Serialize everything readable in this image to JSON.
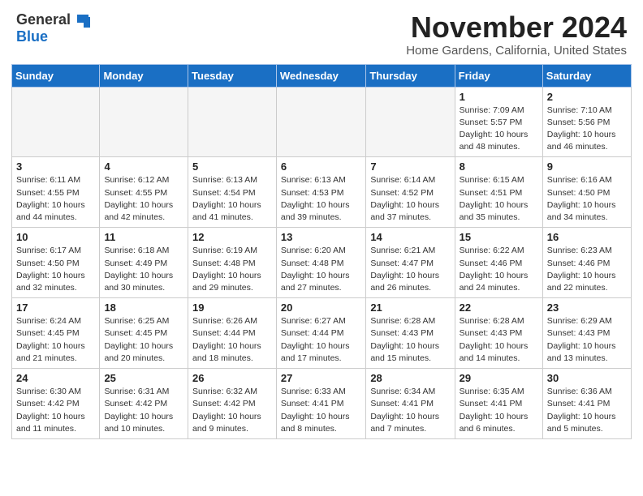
{
  "header": {
    "logo_general": "General",
    "logo_blue": "Blue",
    "month_title": "November 2024",
    "location": "Home Gardens, California, United States"
  },
  "weekdays": [
    "Sunday",
    "Monday",
    "Tuesday",
    "Wednesday",
    "Thursday",
    "Friday",
    "Saturday"
  ],
  "weeks": [
    [
      {
        "day": "",
        "empty": true
      },
      {
        "day": "",
        "empty": true
      },
      {
        "day": "",
        "empty": true
      },
      {
        "day": "",
        "empty": true
      },
      {
        "day": "",
        "empty": true
      },
      {
        "day": "1",
        "sunrise": "Sunrise: 7:09 AM",
        "sunset": "Sunset: 5:57 PM",
        "daylight": "Daylight: 10 hours and 48 minutes."
      },
      {
        "day": "2",
        "sunrise": "Sunrise: 7:10 AM",
        "sunset": "Sunset: 5:56 PM",
        "daylight": "Daylight: 10 hours and 46 minutes."
      }
    ],
    [
      {
        "day": "3",
        "sunrise": "Sunrise: 6:11 AM",
        "sunset": "Sunset: 4:55 PM",
        "daylight": "Daylight: 10 hours and 44 minutes."
      },
      {
        "day": "4",
        "sunrise": "Sunrise: 6:12 AM",
        "sunset": "Sunset: 4:55 PM",
        "daylight": "Daylight: 10 hours and 42 minutes."
      },
      {
        "day": "5",
        "sunrise": "Sunrise: 6:13 AM",
        "sunset": "Sunset: 4:54 PM",
        "daylight": "Daylight: 10 hours and 41 minutes."
      },
      {
        "day": "6",
        "sunrise": "Sunrise: 6:13 AM",
        "sunset": "Sunset: 4:53 PM",
        "daylight": "Daylight: 10 hours and 39 minutes."
      },
      {
        "day": "7",
        "sunrise": "Sunrise: 6:14 AM",
        "sunset": "Sunset: 4:52 PM",
        "daylight": "Daylight: 10 hours and 37 minutes."
      },
      {
        "day": "8",
        "sunrise": "Sunrise: 6:15 AM",
        "sunset": "Sunset: 4:51 PM",
        "daylight": "Daylight: 10 hours and 35 minutes."
      },
      {
        "day": "9",
        "sunrise": "Sunrise: 6:16 AM",
        "sunset": "Sunset: 4:50 PM",
        "daylight": "Daylight: 10 hours and 34 minutes."
      }
    ],
    [
      {
        "day": "10",
        "sunrise": "Sunrise: 6:17 AM",
        "sunset": "Sunset: 4:50 PM",
        "daylight": "Daylight: 10 hours and 32 minutes."
      },
      {
        "day": "11",
        "sunrise": "Sunrise: 6:18 AM",
        "sunset": "Sunset: 4:49 PM",
        "daylight": "Daylight: 10 hours and 30 minutes."
      },
      {
        "day": "12",
        "sunrise": "Sunrise: 6:19 AM",
        "sunset": "Sunset: 4:48 PM",
        "daylight": "Daylight: 10 hours and 29 minutes."
      },
      {
        "day": "13",
        "sunrise": "Sunrise: 6:20 AM",
        "sunset": "Sunset: 4:48 PM",
        "daylight": "Daylight: 10 hours and 27 minutes."
      },
      {
        "day": "14",
        "sunrise": "Sunrise: 6:21 AM",
        "sunset": "Sunset: 4:47 PM",
        "daylight": "Daylight: 10 hours and 26 minutes."
      },
      {
        "day": "15",
        "sunrise": "Sunrise: 6:22 AM",
        "sunset": "Sunset: 4:46 PM",
        "daylight": "Daylight: 10 hours and 24 minutes."
      },
      {
        "day": "16",
        "sunrise": "Sunrise: 6:23 AM",
        "sunset": "Sunset: 4:46 PM",
        "daylight": "Daylight: 10 hours and 22 minutes."
      }
    ],
    [
      {
        "day": "17",
        "sunrise": "Sunrise: 6:24 AM",
        "sunset": "Sunset: 4:45 PM",
        "daylight": "Daylight: 10 hours and 21 minutes."
      },
      {
        "day": "18",
        "sunrise": "Sunrise: 6:25 AM",
        "sunset": "Sunset: 4:45 PM",
        "daylight": "Daylight: 10 hours and 20 minutes."
      },
      {
        "day": "19",
        "sunrise": "Sunrise: 6:26 AM",
        "sunset": "Sunset: 4:44 PM",
        "daylight": "Daylight: 10 hours and 18 minutes."
      },
      {
        "day": "20",
        "sunrise": "Sunrise: 6:27 AM",
        "sunset": "Sunset: 4:44 PM",
        "daylight": "Daylight: 10 hours and 17 minutes."
      },
      {
        "day": "21",
        "sunrise": "Sunrise: 6:28 AM",
        "sunset": "Sunset: 4:43 PM",
        "daylight": "Daylight: 10 hours and 15 minutes."
      },
      {
        "day": "22",
        "sunrise": "Sunrise: 6:28 AM",
        "sunset": "Sunset: 4:43 PM",
        "daylight": "Daylight: 10 hours and 14 minutes."
      },
      {
        "day": "23",
        "sunrise": "Sunrise: 6:29 AM",
        "sunset": "Sunset: 4:43 PM",
        "daylight": "Daylight: 10 hours and 13 minutes."
      }
    ],
    [
      {
        "day": "24",
        "sunrise": "Sunrise: 6:30 AM",
        "sunset": "Sunset: 4:42 PM",
        "daylight": "Daylight: 10 hours and 11 minutes."
      },
      {
        "day": "25",
        "sunrise": "Sunrise: 6:31 AM",
        "sunset": "Sunset: 4:42 PM",
        "daylight": "Daylight: 10 hours and 10 minutes."
      },
      {
        "day": "26",
        "sunrise": "Sunrise: 6:32 AM",
        "sunset": "Sunset: 4:42 PM",
        "daylight": "Daylight: 10 hours and 9 minutes."
      },
      {
        "day": "27",
        "sunrise": "Sunrise: 6:33 AM",
        "sunset": "Sunset: 4:41 PM",
        "daylight": "Daylight: 10 hours and 8 minutes."
      },
      {
        "day": "28",
        "sunrise": "Sunrise: 6:34 AM",
        "sunset": "Sunset: 4:41 PM",
        "daylight": "Daylight: 10 hours and 7 minutes."
      },
      {
        "day": "29",
        "sunrise": "Sunrise: 6:35 AM",
        "sunset": "Sunset: 4:41 PM",
        "daylight": "Daylight: 10 hours and 6 minutes."
      },
      {
        "day": "30",
        "sunrise": "Sunrise: 6:36 AM",
        "sunset": "Sunset: 4:41 PM",
        "daylight": "Daylight: 10 hours and 5 minutes."
      }
    ]
  ]
}
